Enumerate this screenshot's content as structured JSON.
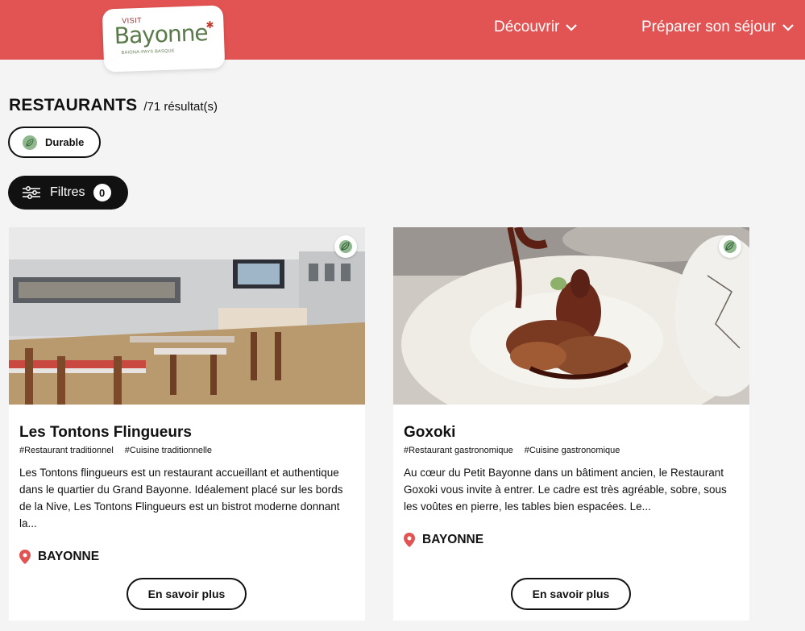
{
  "header": {
    "logo": {
      "visit": "VISIT",
      "name": "Bayonne",
      "tagline": "BAIONA-PAYS BASQUE"
    },
    "nav": [
      {
        "label": "Découvrir"
      },
      {
        "label": "Préparer son séjour"
      }
    ],
    "colors": {
      "header_bg": "#e25353"
    }
  },
  "page": {
    "title": "RESTAURANTS",
    "result_count": "/71 résultat(s)",
    "durable_chip": {
      "label": "Durable",
      "icon": "leaf-icon"
    },
    "filters_button": {
      "label": "Filtres",
      "count": "0",
      "icon": "sliders-icon"
    }
  },
  "cards": [
    {
      "title": "Les Tontons Flingueurs",
      "tags": [
        "#Restaurant traditionnel",
        "#Cuisine traditionnelle"
      ],
      "description": "Les Tontons flingueurs est un restaurant accueillant et authentique dans le quartier du Grand Bayonne. Idéalement placé sur les bords de la Nive, Les Tontons Flingueurs est un bistrot moderne donnant la...",
      "location": "BAYONNE",
      "button": "En savoir plus",
      "image": "restaurant-interior-photo"
    },
    {
      "title": "Goxoki",
      "tags": [
        "#Restaurant gastronomique",
        "#Cuisine gastronomique"
      ],
      "description": "Au cœur du Petit Bayonne dans un bâtiment ancien, le Restaurant Goxoki vous invite à entrer. Le cadre est très agréable, sobre, sous les voûtes en pierre, les tables bien espacées. Le...",
      "location": "BAYONNE",
      "button": "En savoir plus",
      "image": "plated-dish-photo"
    }
  ]
}
